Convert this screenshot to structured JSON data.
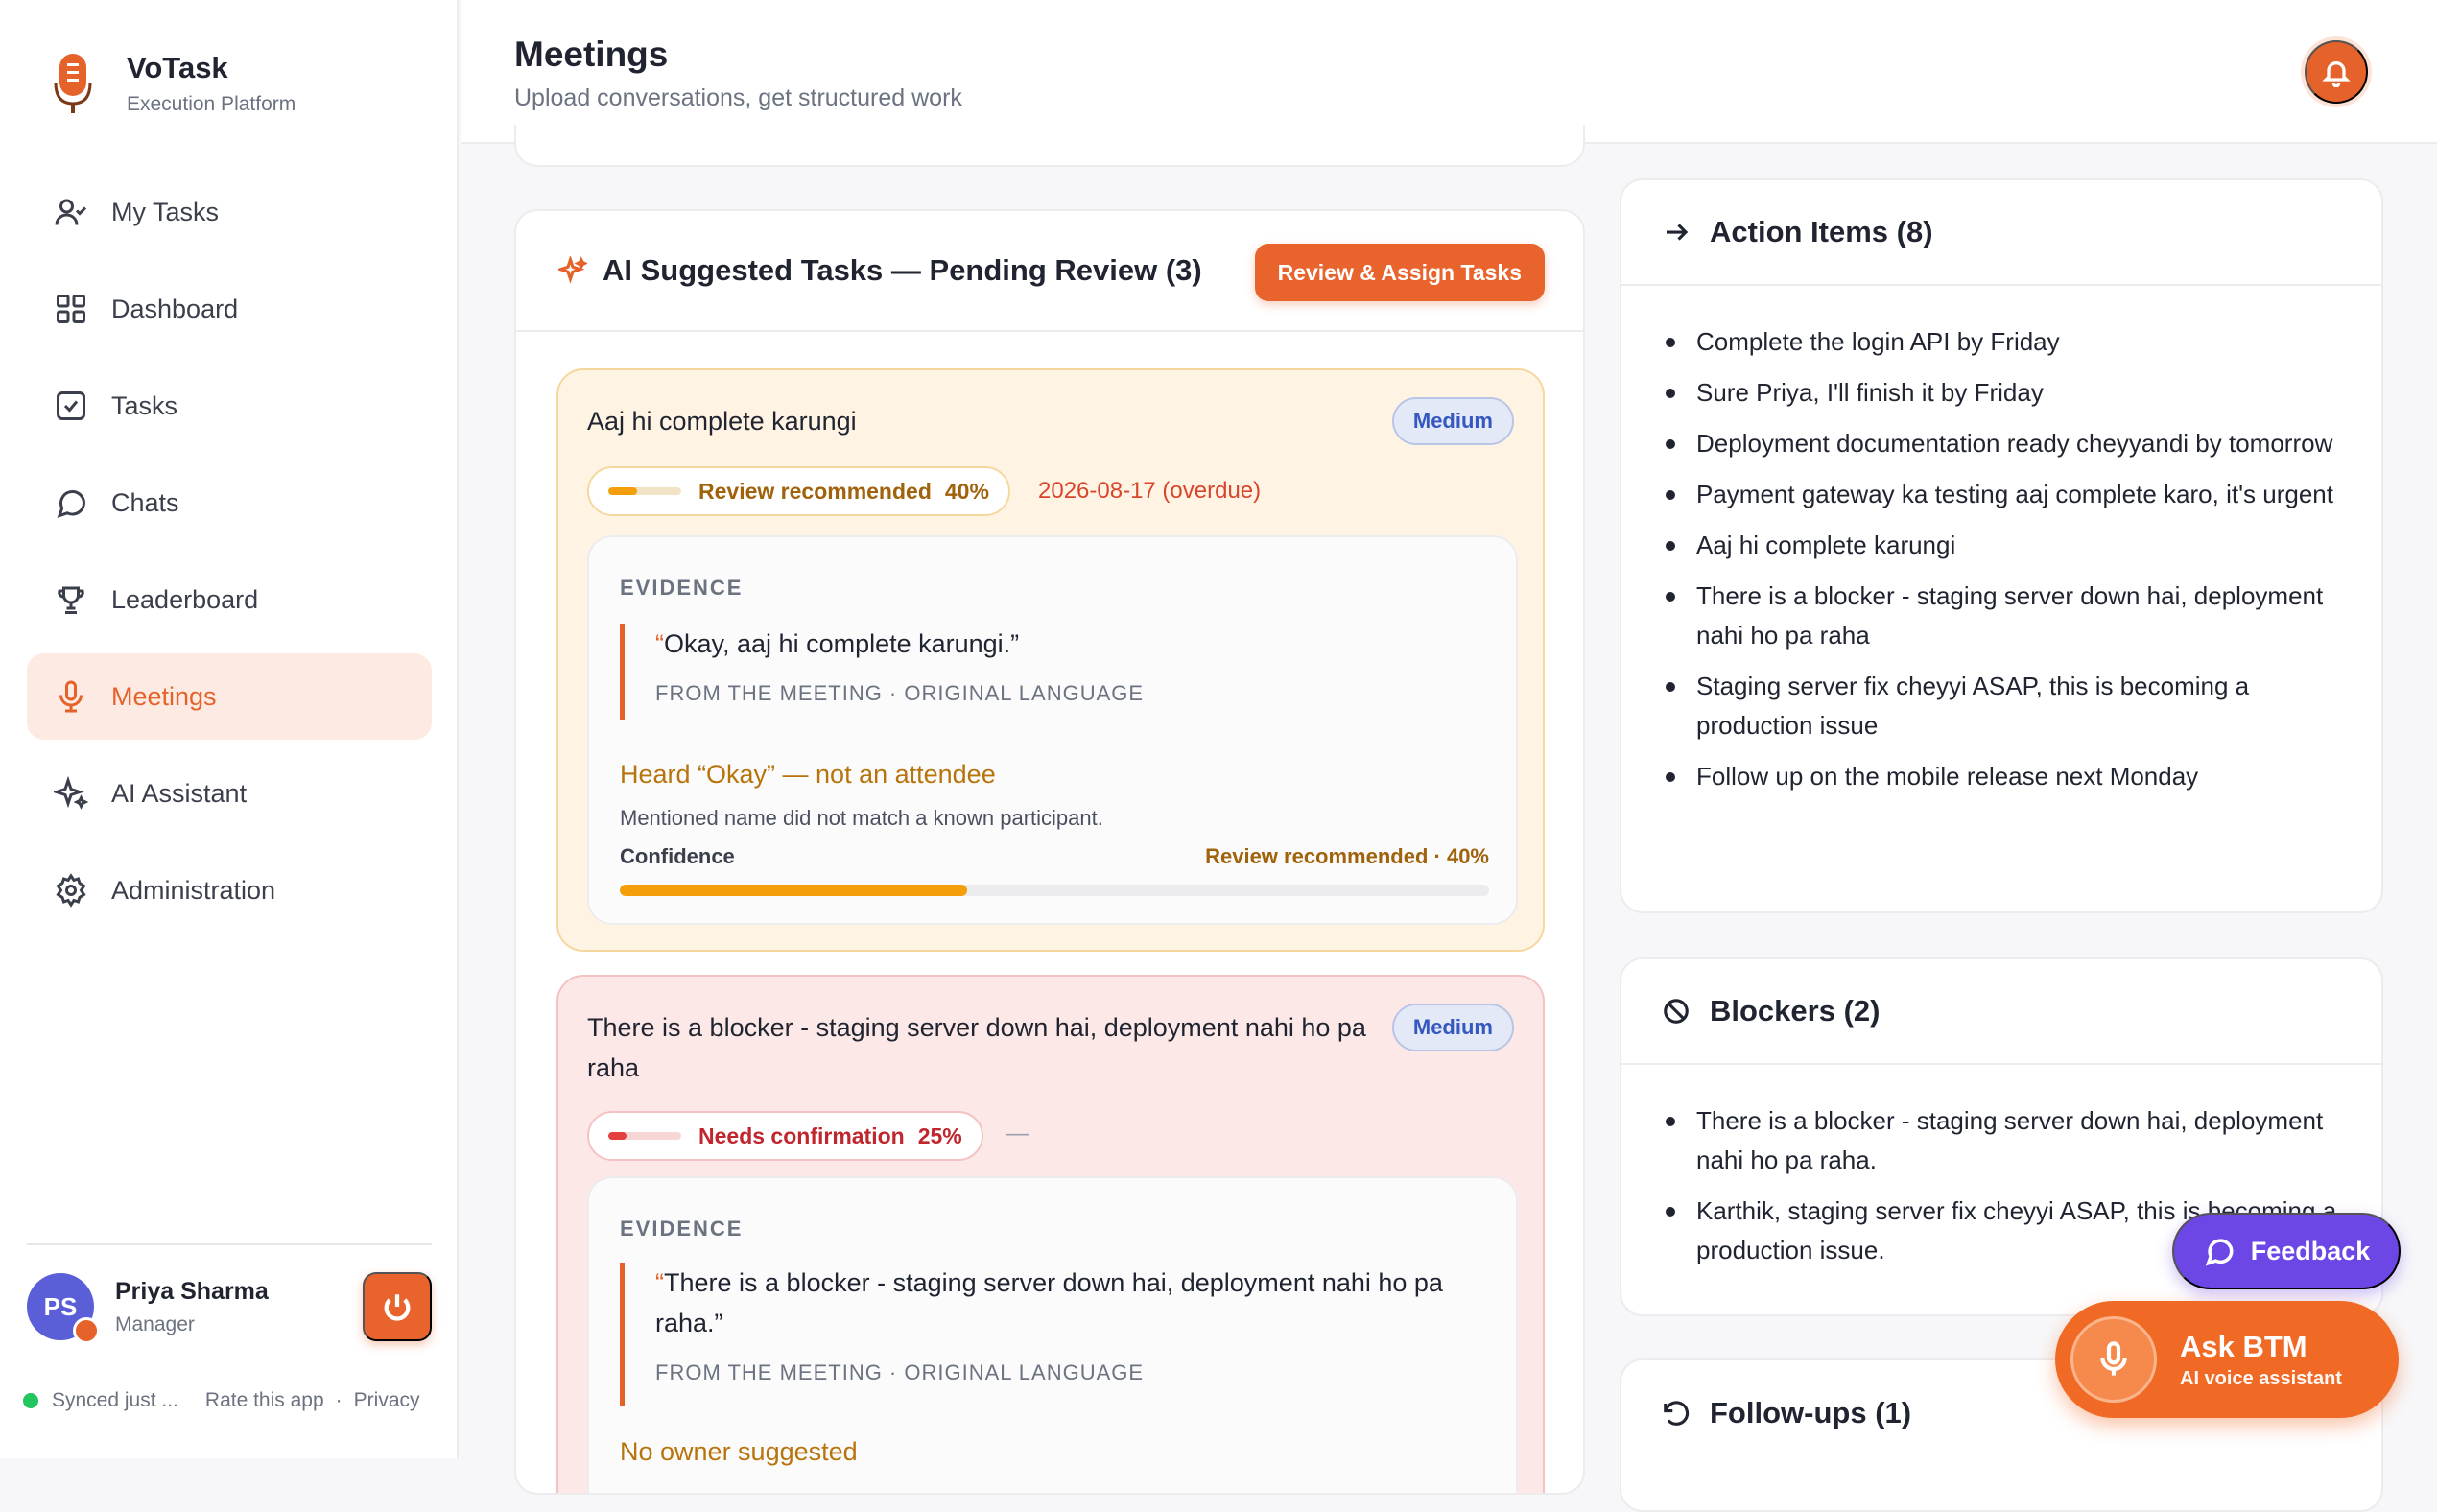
{
  "brand": {
    "title": "VoTask",
    "subtitle": "Execution Platform"
  },
  "nav": [
    {
      "label": "My Tasks",
      "icon": "user-check-icon"
    },
    {
      "label": "Dashboard",
      "icon": "grid-icon"
    },
    {
      "label": "Tasks",
      "icon": "checkbox-icon"
    },
    {
      "label": "Chats",
      "icon": "chat-bubble-icon"
    },
    {
      "label": "Leaderboard",
      "icon": "trophy-icon"
    },
    {
      "label": "Meetings",
      "icon": "microphone-icon",
      "active": true
    },
    {
      "label": "AI Assistant",
      "icon": "sparkles-icon"
    },
    {
      "label": "Administration",
      "icon": "gear-icon"
    }
  ],
  "user": {
    "initials": "PS",
    "name": "Priya Sharma",
    "role": "Manager"
  },
  "footer": {
    "sync": "Synced just ...",
    "rate": "Rate this app",
    "sep": "·",
    "privacy": "Privacy"
  },
  "header": {
    "title": "Meetings",
    "subtitle": "Upload conversations, get structured work"
  },
  "suggested": {
    "title": "AI Suggested Tasks — Pending Review (3)",
    "button": "Review & Assign Tasks",
    "tasks": [
      {
        "title": "Aaj hi complete karungi",
        "priority": "Medium",
        "status_label": "Review recommended",
        "confidence": 0.4,
        "confidence_text": "40%",
        "due": "2026-08-17 (overdue)",
        "evidence_label": "EVIDENCE",
        "open_quote": "“",
        "quote": "Okay, aaj hi complete karungi.”",
        "source": "FROM THE MEETING · ORIGINAL LANGUAGE",
        "warning": "Heard “Okay” — not an attendee",
        "warning_detail": "Mentioned name did not match a known participant.",
        "confidence_label": "Confidence",
        "confidence_summary": "Review recommended · 40%"
      },
      {
        "title": "There is a blocker - staging server down hai, deployment nahi ho pa raha",
        "priority": "Medium",
        "status_label": "Needs confirmation",
        "confidence": 0.25,
        "confidence_text": "25%",
        "due": "—",
        "evidence_label": "EVIDENCE",
        "open_quote": "“",
        "quote": "There is a blocker - staging server down hai, deployment nahi ho pa raha.”",
        "source": "FROM THE MEETING · ORIGINAL LANGUAGE",
        "warning": "No owner suggested"
      }
    ]
  },
  "action_items": {
    "title": "Action Items (8)",
    "items": [
      "Complete the login API by Friday",
      "Sure Priya, I'll finish it by Friday",
      "Deployment documentation ready cheyyandi by tomorrow",
      "Payment gateway ka testing aaj complete karo, it's urgent",
      "Aaj hi complete karungi",
      "There is a blocker - staging server down hai, deployment nahi ho pa raha",
      "Staging server fix cheyyi ASAP, this is becoming a production issue",
      "Follow up on the mobile release next Monday"
    ]
  },
  "blockers": {
    "title": "Blockers (2)",
    "items": [
      "There is a blocker - staging server down hai, deployment nahi ho pa raha.",
      "Karthik, staging server fix cheyyi ASAP, this is becoming a production issue."
    ]
  },
  "followups": {
    "title": "Follow-ups (1)"
  },
  "feedback": {
    "label": "Feedback"
  },
  "ask": {
    "title": "Ask BTM",
    "subtitle": "AI voice assistant"
  },
  "colors": {
    "accent": "#e5622a",
    "feedback": "#6d46e6",
    "warning": "#f59e0b",
    "danger": "#e53e3e"
  }
}
